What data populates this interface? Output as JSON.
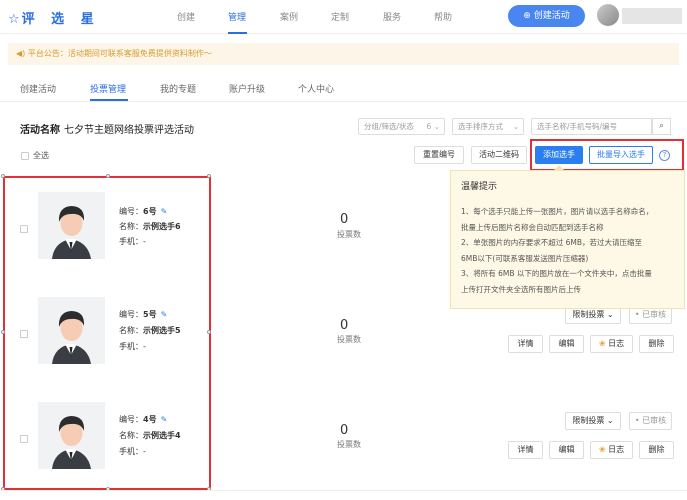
{
  "header": {
    "logo_text": "评 选 星",
    "nav": [
      {
        "label": "创建",
        "active": false
      },
      {
        "label": "管理",
        "active": true
      },
      {
        "label": "案例",
        "active": false
      },
      {
        "label": "定制",
        "active": false
      },
      {
        "label": "服务",
        "active": false
      },
      {
        "label": "帮助",
        "active": false
      }
    ],
    "create_button": "创建活动"
  },
  "notice": {
    "text": "平台公告：活动期间可联系客服免费提供资料制作～"
  },
  "tabs": [
    {
      "label": "创建活动",
      "active": false
    },
    {
      "label": "投票管理",
      "active": true
    },
    {
      "label": "我的专题",
      "active": false
    },
    {
      "label": "账户升级",
      "active": false
    },
    {
      "label": "个人中心",
      "active": false
    }
  ],
  "activity": {
    "label": "活动名称",
    "name": "七夕节主题网络投票评选活动"
  },
  "filters": {
    "group_status": "分组/筛选/状态",
    "group_count": "6",
    "sort": "选手排序方式",
    "search_placeholder": "选手名称/手机号码/编号"
  },
  "toolbar": {
    "select_all": "全选",
    "reset_numbers": "重置编号",
    "qrcode": "活动二维码",
    "add_player": "添加选手",
    "batch_import": "批量导入选手"
  },
  "tooltip": {
    "title": "温馨提示",
    "lines": [
      "1、每个选手只能上传一张图片，图片请以选手名称命名，",
      "批量上传后图片名称会自动匹配到选手名称",
      "2、单张图片的内存要求不超过 6MB，若过大请压缩至",
      "6MB以下(可联系客服发送图片压缩器)",
      "3、将所有 6MB 以下的图片放在一个文件夹中，点击批量",
      "上传打开文件夹全选所有图片后上传"
    ]
  },
  "labels": {
    "number": "编号：",
    "name": "名称：",
    "phone": "手机：",
    "votes": "投票数",
    "limit_vote": "限制投票",
    "audited": "已审核",
    "details": "详情",
    "edit": "编辑",
    "log": "日志",
    "delete": "删除"
  },
  "players": [
    {
      "number": "6号",
      "name": "示例选手6",
      "phone": "-",
      "votes": "0"
    },
    {
      "number": "5号",
      "name": "示例选手5",
      "phone": "-",
      "votes": "0"
    },
    {
      "number": "4号",
      "name": "示例选手4",
      "phone": "-",
      "votes": "0"
    }
  ],
  "colors": {
    "accent": "#2a7ef0",
    "highlight_border": "#e0303a",
    "notice_text": "#d99a30"
  }
}
